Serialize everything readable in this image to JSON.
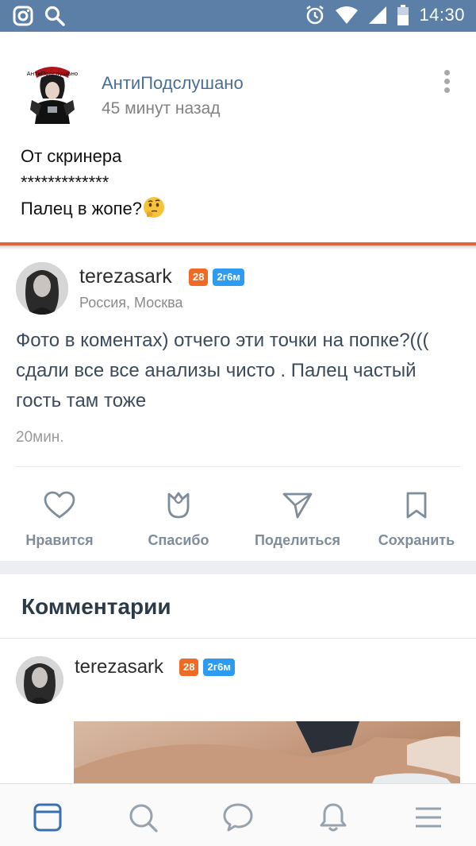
{
  "status_bar": {
    "time": "14:30",
    "left_icons": [
      "instagram-icon",
      "search-icon"
    ],
    "right_icons": [
      "alarm-icon",
      "wifi-icon",
      "signal-icon",
      "battery-icon"
    ]
  },
  "top_post": {
    "group_name": "АнтиПодслушано",
    "avatar_logo_text": "АнтиПодслушано",
    "time": "45 минут назад",
    "body_lines": [
      "От скринера",
      "*************",
      "Палец в жопе?"
    ],
    "emoji": "thinking-face"
  },
  "main_post": {
    "username": "terezasark",
    "age_badge": "28",
    "tag_badge": "2г6м",
    "location": "Россия, Москва",
    "text": "Фото в коментах) отчего эти точки на попке?((( сдали все все анализы чисто . Палец частый гость там тоже",
    "ago": "20мин."
  },
  "actions": [
    {
      "label": "Нравится",
      "icon": "heart-icon"
    },
    {
      "label": "Спасибо",
      "icon": "tulip-icon"
    },
    {
      "label": "Поделиться",
      "icon": "share-icon"
    },
    {
      "label": "Сохранить",
      "icon": "bookmark-icon"
    }
  ],
  "comments": {
    "title": "Комментарии",
    "items": [
      {
        "username": "terezasark",
        "age_badge": "28",
        "tag_badge": "2г6м"
      }
    ]
  },
  "bottom_nav": [
    "feed-icon",
    "search-icon",
    "messages-icon",
    "notifications-icon",
    "menu-icon"
  ],
  "colors": {
    "status_bar": "#5b7fa6",
    "accent_orange": "#e0643c",
    "badge_orange": "#ef6b25",
    "badge_blue": "#2d9bf0",
    "link_blue": "#4a6e96",
    "nav_active": "#3a6fb0"
  }
}
